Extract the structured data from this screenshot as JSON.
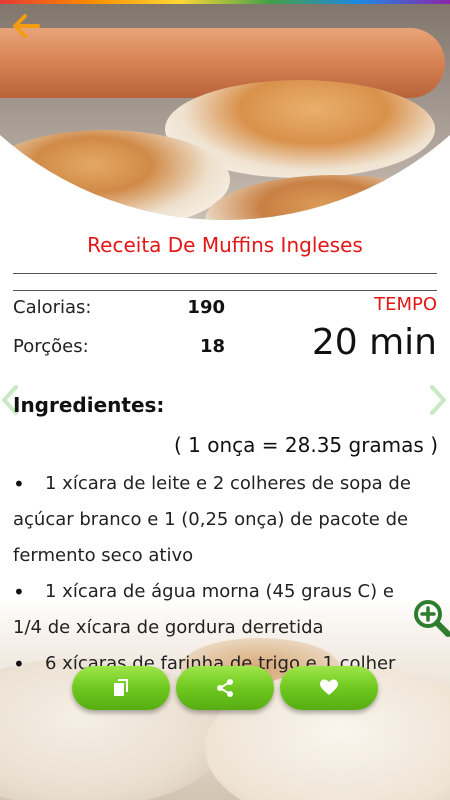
{
  "recipe": {
    "title": "Receita De Muffins Ingleses"
  },
  "stats": {
    "calories_label": "Calorias:",
    "calories_value": "190",
    "servings_label": "Porções:",
    "servings_value": "18",
    "time_label": "TEMPO",
    "time_value": "20 min"
  },
  "ingredients": {
    "heading": "Ingredientes:",
    "conversion": "( 1 onça = 28.35 gramas )",
    "items": [
      {
        "first": "1 xícara de leite e 2 colheres de sopa de",
        "rest": "açúcar branco e 1 (0,25 onça) de pacote de fermento seco ativo"
      },
      {
        "first": "1 xícara de água morna (45 graus C) e",
        "rest": "1/4 de xícara de gordura derretida"
      },
      {
        "first": "6 xícaras de farinha de trigo e 1 colher",
        "rest": ""
      }
    ]
  },
  "icons": {
    "back": "arrow-left-icon",
    "zoom": "zoom-in-icon",
    "copy": "copy-icon",
    "share": "share-icon",
    "favorite": "heart-icon"
  },
  "colors": {
    "accent": "#e41616",
    "back_arrow": "#f39c12",
    "button_green": "#6fc81f",
    "zoom_green": "#2e7d2e"
  }
}
